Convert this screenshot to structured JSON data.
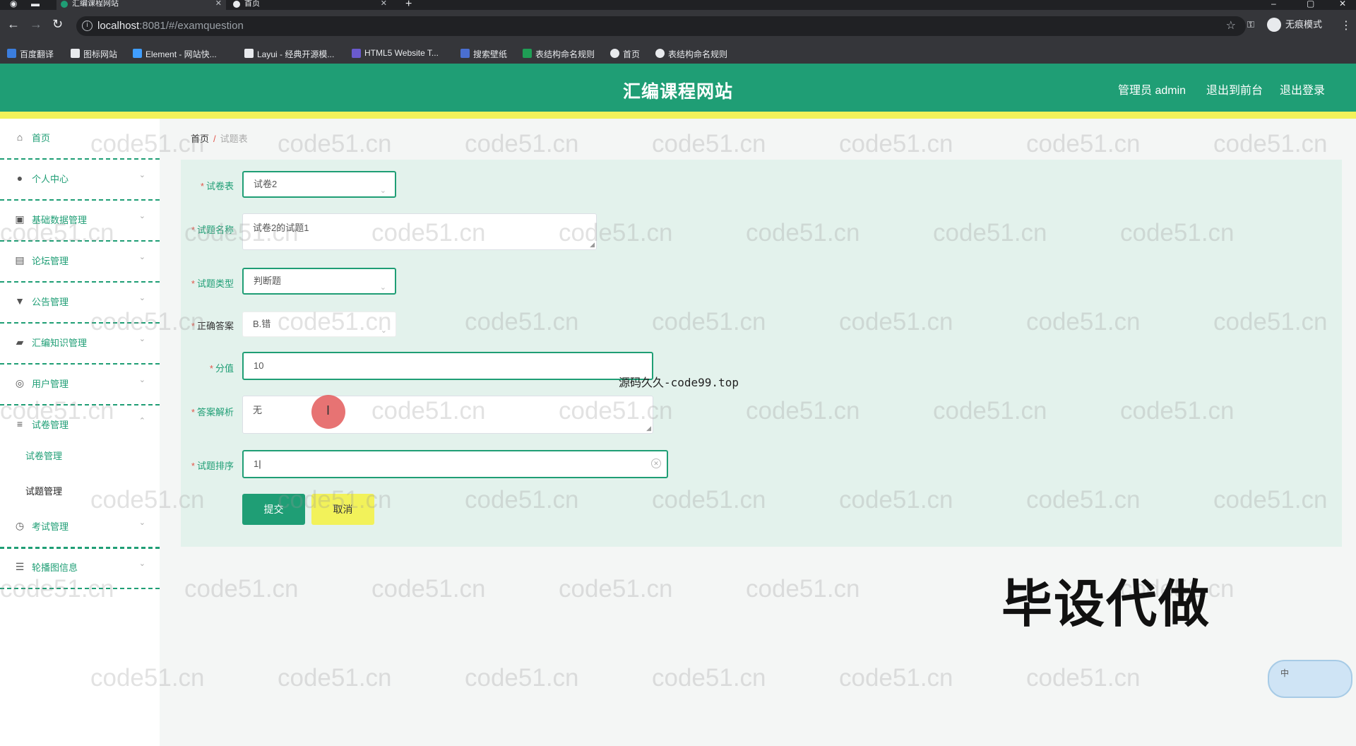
{
  "browser": {
    "tabs": [
      {
        "label": "汇编课程网站",
        "active": true
      },
      {
        "label": "首页",
        "active": false
      }
    ],
    "url_host": "localhost",
    "url_path": ":8081/#/examquestion",
    "profile_label": "无痕模式",
    "bookmarks": [
      "百度翻译",
      "图标网站",
      "Element - 网站快...",
      "Layui - 经典开源模...",
      "HTML5 Website T...",
      "搜索壁纸",
      "表结构命名规则",
      "首页",
      "表结构命名规则"
    ]
  },
  "header": {
    "title": "汇编课程网站",
    "admin_label": "管理员 admin",
    "back_front_label": "退出到前台",
    "logout_label": "退出登录",
    "accent_color": "#1f9e75",
    "strip_color": "#f2f25a"
  },
  "sidebar": {
    "items": [
      {
        "label": "首页",
        "icon": "home-icon"
      },
      {
        "label": "个人中心",
        "icon": "user-icon"
      },
      {
        "label": "基础数据管理",
        "icon": "database-icon"
      },
      {
        "label": "论坛管理",
        "icon": "forum-icon"
      },
      {
        "label": "公告管理",
        "icon": "announcement-icon"
      },
      {
        "label": "汇编知识管理",
        "icon": "knowledge-icon"
      },
      {
        "label": "用户管理",
        "icon": "users-icon"
      },
      {
        "label": "试卷管理",
        "icon": "list-icon"
      },
      {
        "label": "考试管理",
        "icon": "clock-icon"
      },
      {
        "label": "轮播图信息",
        "icon": "sliders-icon"
      }
    ],
    "sub_items": [
      {
        "label": "试卷管理",
        "active": false
      },
      {
        "label": "试题管理",
        "active": true
      }
    ]
  },
  "breadcrumb": {
    "home": "首页",
    "separator": "/",
    "current": "试题表"
  },
  "form": {
    "exam_paper": {
      "label": "试卷表",
      "value": "试卷2"
    },
    "question_name": {
      "label": "试题名称",
      "value": "试卷2的试题1"
    },
    "question_type": {
      "label": "试题类型",
      "value": "判断题"
    },
    "correct_answer": {
      "label": "正确答案",
      "value": "B.错"
    },
    "score": {
      "label": "分值",
      "value": "10"
    },
    "analysis": {
      "label": "答案解析",
      "value": "无"
    },
    "order": {
      "label": "试题排序",
      "value": "1"
    },
    "submit_label": "提交",
    "cancel_label": "取消"
  },
  "watermarks": {
    "site": "code51.cn",
    "source": "源码久久-code99.top",
    "big": "毕设代做",
    "ime_label": "中"
  }
}
